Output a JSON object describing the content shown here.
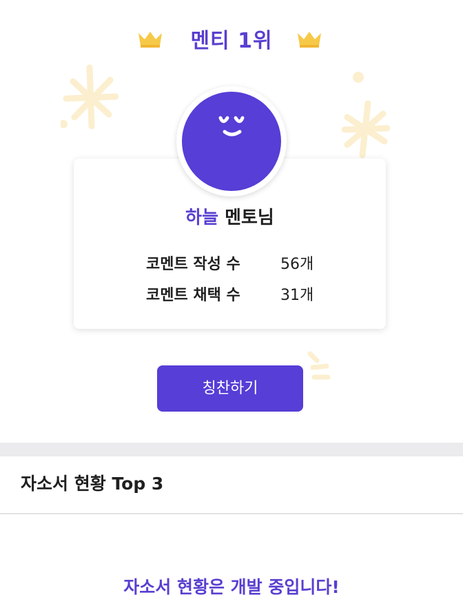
{
  "ranking": {
    "title": "멘티 1위",
    "left_icon": "crown-icon",
    "right_icon": "crown-icon"
  },
  "mentor": {
    "name": "하늘",
    "suffix": "멘토님",
    "avatar_icon": "smiley-face-icon"
  },
  "stats": [
    {
      "label": "코멘트 작성 수",
      "value": "56개"
    },
    {
      "label": "코멘트 채택 수",
      "value": "31개"
    }
  ],
  "praise_button": {
    "label": "칭찬하기"
  },
  "section": {
    "title": "자소서 현황 Top 3",
    "empty_message": "자소서 현황은 개발 중입니다!"
  },
  "colors": {
    "accent": "#563ed6",
    "accent_text": "#5a3fd0",
    "crown": "#f7c948",
    "sparkle": "#fcefcf",
    "divider": "#ebebee"
  }
}
